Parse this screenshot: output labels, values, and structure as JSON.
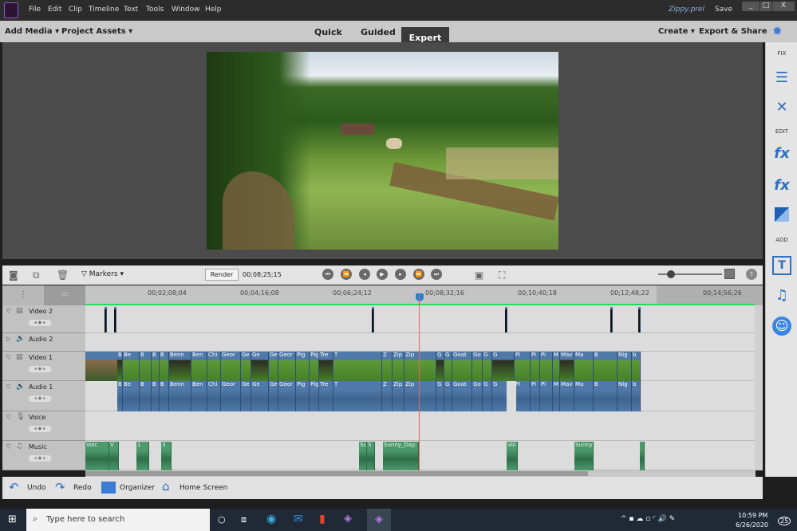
{
  "menu": [
    "File",
    "Edit",
    "Clip",
    "Timeline",
    "Text",
    "Tools",
    "Window",
    "Help"
  ],
  "project_name": "Zippy.prel",
  "save_label": "Save",
  "window_controls": {
    "minimize": "_",
    "maximize": "□",
    "close": "X"
  },
  "modebar": {
    "add_media": "Add Media ▾",
    "project_assets": "Project Assets ▾",
    "quick": "Quick",
    "guided": "Guided",
    "expert": "Expert",
    "create": "Create ▾",
    "export": "Export & Share"
  },
  "right_panel": {
    "fix": "FIX",
    "edit": "EDIT",
    "add": "ADD"
  },
  "toolbar": {
    "markers": "Markers",
    "render": "Render",
    "timecode": "00;08;25;15"
  },
  "ruler_ticks": [
    "00;02;08;04",
    "00;04;16;08",
    "00;06;24;12",
    "00;08;32;16",
    "00;10;40;18",
    "00;12;48;22",
    "00;14;56;26"
  ],
  "tracks": [
    "Video 2",
    "Audio 2",
    "Video 1",
    "Audio 1",
    "Voice",
    "Music"
  ],
  "video1_clips": [
    "B",
    "Be",
    "B",
    "B",
    "B",
    "Benn",
    "Ben",
    "Chi",
    "Geor",
    "Ge",
    "Ge",
    "Ge",
    "Geor",
    "Pig",
    "Pig",
    "Tre",
    "T",
    "Z",
    "Zip",
    "Zip",
    "G",
    "G",
    "Goat",
    "Go",
    "G",
    "G",
    "Pi",
    "Pi",
    "Pi",
    "M",
    "Mav",
    "Ma",
    "B",
    "Nig",
    "b"
  ],
  "music_clips": [
    "Voic",
    "V",
    "1",
    "3",
    "Su",
    "S",
    "Sunny_Day.",
    "Voi",
    "Sunny",
    ""
  ],
  "bottombar": {
    "undo": "Undo",
    "redo": "Redo",
    "organizer": "Organizer",
    "home": "Home Screen"
  },
  "taskbar": {
    "search_placeholder": "Type here to search",
    "time": "10:59 PM",
    "date": "6/26/2020",
    "notifications": "25"
  },
  "colors": {
    "accent": "#2d6fc0",
    "video_clip": "#4f79a8",
    "music_clip": "#4d9a6c",
    "playhead": "#f06060",
    "timeline_green": "#22dd55"
  }
}
